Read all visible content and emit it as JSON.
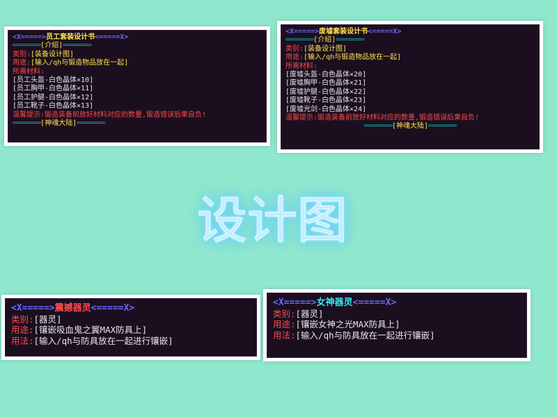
{
  "center_title": "设计图",
  "cards": {
    "employee": {
      "title": "员工套装设计书",
      "deco_left": "<X=====>",
      "deco_right": "<=====X>",
      "ribbon": "════════",
      "intro": "[介绍]",
      "type_label": "类别:",
      "type_value": "[装备设计图]",
      "use_label": "用途:",
      "use_value": "[输入/qh与锻造物品放在一起]",
      "materials_label": "所需材料:",
      "materials": [
        "[员工头盔-白色晶体×10]",
        "[员工胸甲-白色晶体×11]",
        "[员工护腿-白色晶体×12]",
        "[员工靴子-白色晶体×13]"
      ],
      "warning": "温馨提示:锻造装备前放好材料对应的数量,锻造错误后果自负!",
      "footer": "[神魂大陆]"
    },
    "ruins": {
      "title": "废墟套装设计书",
      "deco_left": "<X=====>",
      "deco_right": "<=====X>",
      "ribbon": "════════",
      "intro": "[介绍]",
      "type_label": "类别:",
      "type_value": "[装备设计图]",
      "use_label": "用途:",
      "use_value": "[输入/qh与锻造物品放在一起]",
      "materials_label": "所需材料:",
      "materials": [
        "[废墟头盔-白色晶体×20]",
        "[废墟胸甲-白色晶体×21]",
        "[废墟护腿-白色晶体×22]",
        "[废墟靴子-白色晶体×23]",
        "[废墟光剑-白色晶体×24]"
      ],
      "warning": "温馨提示:锻造装备前放好材料对应的数量,锻造错误后果自负!",
      "footer": "[神魂大陆]"
    },
    "vampire": {
      "title": "震撼器灵",
      "deco_left": "<X=====>",
      "deco_right": "<=====X>",
      "type_label": "类别:",
      "type_value": "[器灵]",
      "use_label": "用途:",
      "use_value": "[镶嵌吸血鬼之翼MAX防具上]",
      "method_label": "用法:",
      "method_value": "[输入/qh与防具放在一起进行镶嵌]"
    },
    "goddess": {
      "title": "女神器灵",
      "deco_left": "<X=====>",
      "deco_right": "<=====X>",
      "type_label": "类别:",
      "type_value": "[器灵]",
      "use_label": "用途:",
      "use_value": "[镶嵌女神之光MAX防具上]",
      "method_label": "用法:",
      "method_value": "[输入/qh与防具放在一起进行镶嵌]"
    }
  },
  "colors": {
    "background": "#8fe7ce",
    "tooltip_bg": "#1b0f1f",
    "gold": "#ffe24a",
    "aqua": "#35e6f0",
    "red": "#ff4a4a",
    "deco_blue": "#6a6aff",
    "teal": "#1aa6a6"
  }
}
